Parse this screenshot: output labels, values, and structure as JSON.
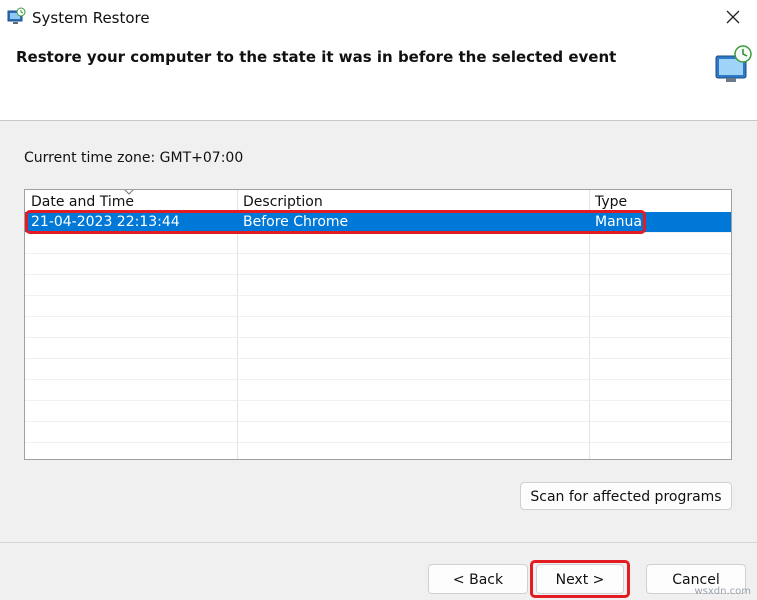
{
  "window": {
    "title": "System Restore",
    "header": "Restore your computer to the state it was in before the selected event",
    "icons": {
      "app": "system-restore-icon",
      "header": "system-restore-monitor-icon",
      "close": "close-icon"
    }
  },
  "timezone": {
    "label": "Current time zone: GMT+07:00"
  },
  "list": {
    "columns": [
      "Date and Time",
      "Description",
      "Type"
    ],
    "rows": [
      {
        "date_time": "21-04-2023 22:13:44",
        "description": "Before Chrome",
        "type": "Manual",
        "selected": true
      }
    ],
    "empty_rows": 11
  },
  "buttons": {
    "scan": "Scan for affected programs",
    "back": "< Back",
    "next": "Next >",
    "cancel": "Cancel"
  },
  "colors": {
    "selection": "#0078d7",
    "highlight": "#e31b23"
  },
  "watermark": "wsxdn.com"
}
